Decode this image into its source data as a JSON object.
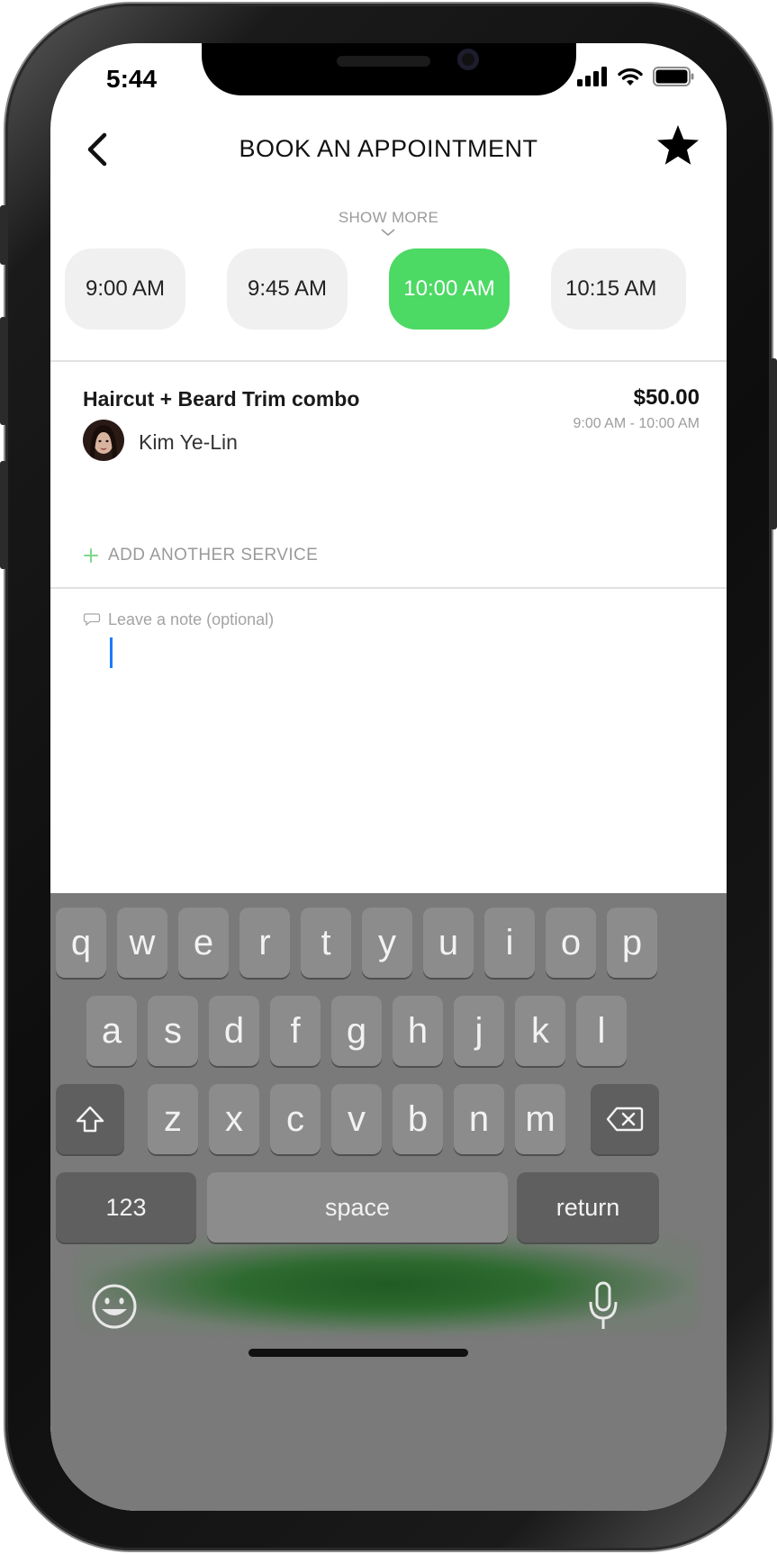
{
  "status_bar": {
    "time": "5:44"
  },
  "header": {
    "title": "BOOK AN APPOINTMENT",
    "show_more": "SHOW MORE"
  },
  "time_slots": [
    {
      "label": "9:00 AM",
      "selected": false
    },
    {
      "label": "9:45 AM",
      "selected": false
    },
    {
      "label": "10:00 AM",
      "selected": true
    },
    {
      "label": "10:15 AM",
      "selected": false
    }
  ],
  "service": {
    "name": "Haircut + Beard Trim combo",
    "price": "$50.00",
    "time_range": "9:00 AM - 10:00 AM",
    "stylist": "Kim Ye-Lin"
  },
  "add_service": {
    "label": "ADD ANOTHER SERVICE"
  },
  "note": {
    "placeholder": "Leave a note (optional)",
    "value": ""
  },
  "keyboard": {
    "row1": [
      "q",
      "w",
      "e",
      "r",
      "t",
      "y",
      "u",
      "i",
      "o",
      "p"
    ],
    "row2": [
      "a",
      "s",
      "d",
      "f",
      "g",
      "h",
      "j",
      "k",
      "l"
    ],
    "row3": [
      "z",
      "x",
      "c",
      "v",
      "b",
      "n",
      "m"
    ],
    "numbers_key": "123",
    "space_key": "space",
    "return_key": "return"
  },
  "colors": {
    "accent_green": "#4cd964",
    "caret_blue": "#1a7bff",
    "keyboard_bg": "#7a7a7a"
  }
}
